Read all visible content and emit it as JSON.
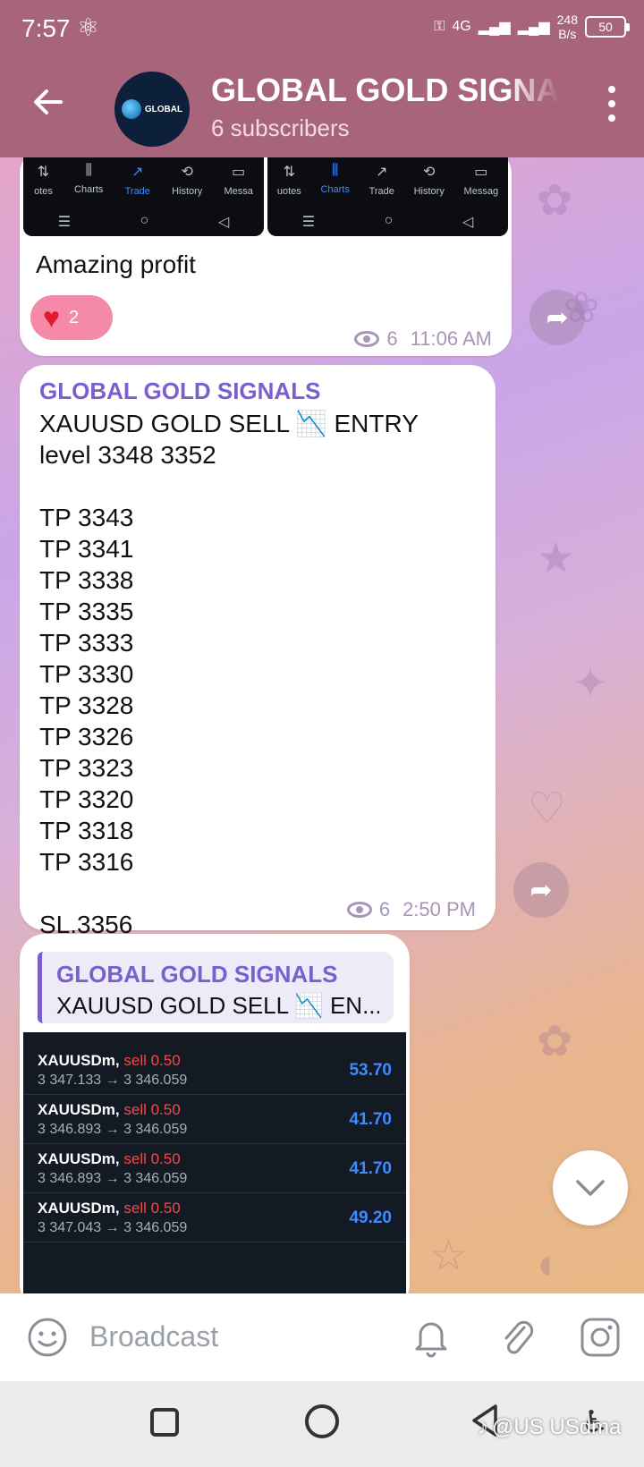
{
  "status_bar": {
    "time": "7:57",
    "net_speed_value": "248",
    "net_speed_unit": "B/s",
    "signal_label": "4G",
    "battery": "50"
  },
  "header": {
    "title": "GLOBAL GOLD SIGNA",
    "subtitle": "6 subscribers",
    "avatar_brand": "GLOBAL"
  },
  "messages": {
    "m1": {
      "shot_left_tabs": [
        "otes",
        "Charts",
        "Trade",
        "History",
        "Messa"
      ],
      "shot_right_tabs": [
        "uotes",
        "Charts",
        "Trade",
        "History",
        "Messag"
      ],
      "caption": "Amazing profit",
      "reaction_count": "2",
      "views": "6",
      "time": "11:06 AM"
    },
    "m2": {
      "sender": "GLOBAL GOLD SIGNALS",
      "lines": [
        "XAUUSD GOLD SELL 📉 ENTRY level 3348 3352",
        "",
        "TP 3343",
        "TP 3341",
        "TP 3338",
        "TP 3335",
        "TP 3333",
        "TP 3330",
        "TP 3328",
        "TP 3326",
        "TP 3323",
        "TP 3320",
        "TP 3318",
        "TP 3316",
        "",
        "SL.3356"
      ],
      "views": "6",
      "time": "2:50 PM"
    },
    "m3": {
      "reply_name": "GLOBAL GOLD SIGNALS",
      "reply_text": "XAUUSD GOLD SELL 📉 EN...",
      "trades": [
        {
          "symbol": "XAUUSDm,",
          "side": "sell 0.50",
          "prices": "3 347.133 → 3 346.059",
          "pnl": "53.70"
        },
        {
          "symbol": "XAUUSDm,",
          "side": "sell 0.50",
          "prices": "3 346.893 → 3 346.059",
          "pnl": "41.70"
        },
        {
          "symbol": "XAUUSDm,",
          "side": "sell 0.50",
          "prices": "3 346.893 → 3 346.059",
          "pnl": "41.70"
        },
        {
          "symbol": "XAUUSDm,",
          "side": "sell 0.50",
          "prices": "3 347.043 → 3 346.059",
          "pnl": "49.20"
        }
      ]
    }
  },
  "input_bar": {
    "placeholder": "Broadcast"
  },
  "watermark": "@US USdma"
}
